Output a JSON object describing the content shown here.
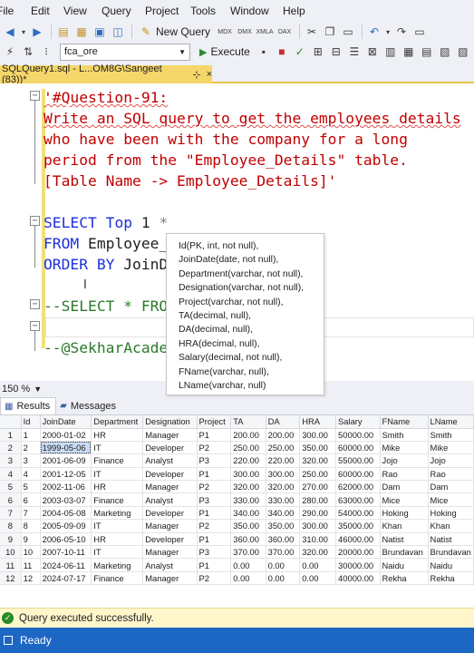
{
  "menu": [
    "File",
    "Edit",
    "View",
    "Query",
    "Project",
    "Tools",
    "Window",
    "Help"
  ],
  "toolbar": {
    "new_query_label": "New Query",
    "database_value": "fca_ore",
    "execute_label": "Execute",
    "sql_buttons": [
      "MDX",
      "DMX",
      "XMLA",
      "DAX"
    ]
  },
  "tab": {
    "title": "SQLQuery1.sql - L...OM8G\\Sangeet (83))*",
    "pin": "⊹",
    "close": "×"
  },
  "editor": {
    "comment_lines": [
      "'#Question-91:",
      "Write an SQL query to get the employees details",
      "who have been with the company for a long",
      "period from the \"Employee_Details\" table.",
      "[Table Name -> Employee_Details]'"
    ],
    "select_kw": "SELECT",
    "top_kw": "Top",
    "top_num": "1",
    "star": "*",
    "from_kw": "FROM",
    "from_obj": "Employee_",
    "order_kw": "ORDER BY",
    "order_obj": "JoinD",
    "commented_select": "--SELECT * FRO",
    "footer_comment": "--@SekharAcade"
  },
  "intellisense": [
    "Id(PK, int, not null),",
    "JoinDate(date, not null),",
    "Department(varchar, not null),",
    "Designation(varchar, not null),",
    "Project(varchar, not null),",
    "TA(decimal, null),",
    "DA(decimal, null),",
    "HRA(decimal, null),",
    "Salary(decimal, not null),",
    "FName(varchar, null),",
    "LName(varchar, null)"
  ],
  "zoom": "150 %",
  "result_tabs": {
    "results": "Results",
    "messages": "Messages"
  },
  "grid": {
    "columns": [
      "Id",
      "JoinDate",
      "Department",
      "Designation",
      "Project",
      "TA",
      "DA",
      "HRA",
      "Salary",
      "FName",
      "LName"
    ],
    "rows": [
      [
        "1",
        "2000-01-02",
        "HR",
        "Manager",
        "P1",
        "200.00",
        "200.00",
        "300.00",
        "50000.00",
        "Smith",
        "Smith"
      ],
      [
        "2",
        "1999-05-06",
        "IT",
        "Developer",
        "P2",
        "250.00",
        "250.00",
        "350.00",
        "60000.00",
        "Mike",
        "Mike"
      ],
      [
        "3",
        "2001-06-09",
        "Finance",
        "Analyst",
        "P3",
        "220.00",
        "220.00",
        "320.00",
        "55000.00",
        "Jojo",
        "Jojo"
      ],
      [
        "4",
        "2001-12-05",
        "IT",
        "Developer",
        "P1",
        "300.00",
        "300.00",
        "250.00",
        "60000.00",
        "Rao",
        "Rao"
      ],
      [
        "5",
        "2002-11-06",
        "HR",
        "Manager",
        "P2",
        "320.00",
        "320.00",
        "270.00",
        "62000.00",
        "Dam",
        "Dam"
      ],
      [
        "6",
        "2003-03-07",
        "Finance",
        "Analyst",
        "P3",
        "330.00",
        "330.00",
        "280.00",
        "63000.00",
        "Mice",
        "Mice"
      ],
      [
        "7",
        "2004-05-08",
        "Marketing",
        "Developer",
        "P1",
        "340.00",
        "340.00",
        "290.00",
        "54000.00",
        "Hoking",
        "Hoking"
      ],
      [
        "8",
        "2005-09-09",
        "IT",
        "Manager",
        "P2",
        "350.00",
        "350.00",
        "300.00",
        "35000.00",
        "Khan",
        "Khan"
      ],
      [
        "9",
        "2006-05-10",
        "HR",
        "Developer",
        "P1",
        "360.00",
        "360.00",
        "310.00",
        "46000.00",
        "Natist",
        "Natist"
      ],
      [
        "10",
        "2007-10-11",
        "IT",
        "Manager",
        "P3",
        "370.00",
        "370.00",
        "320.00",
        "20000.00",
        "Brundavan",
        "Brundavan"
      ],
      [
        "11",
        "2024-06-11",
        "Marketing",
        "Analyst",
        "P1",
        "0.00",
        "0.00",
        "0.00",
        "30000.00",
        "Naidu",
        "Naidu"
      ],
      [
        "12",
        "2024-07-17",
        "Finance",
        "Manager",
        "P2",
        "0.00",
        "0.00",
        "0.00",
        "40000.00",
        "Rekha",
        "Rekha"
      ]
    ]
  },
  "status": {
    "query_message": "Query executed successfully.",
    "app_state": "Ready"
  }
}
